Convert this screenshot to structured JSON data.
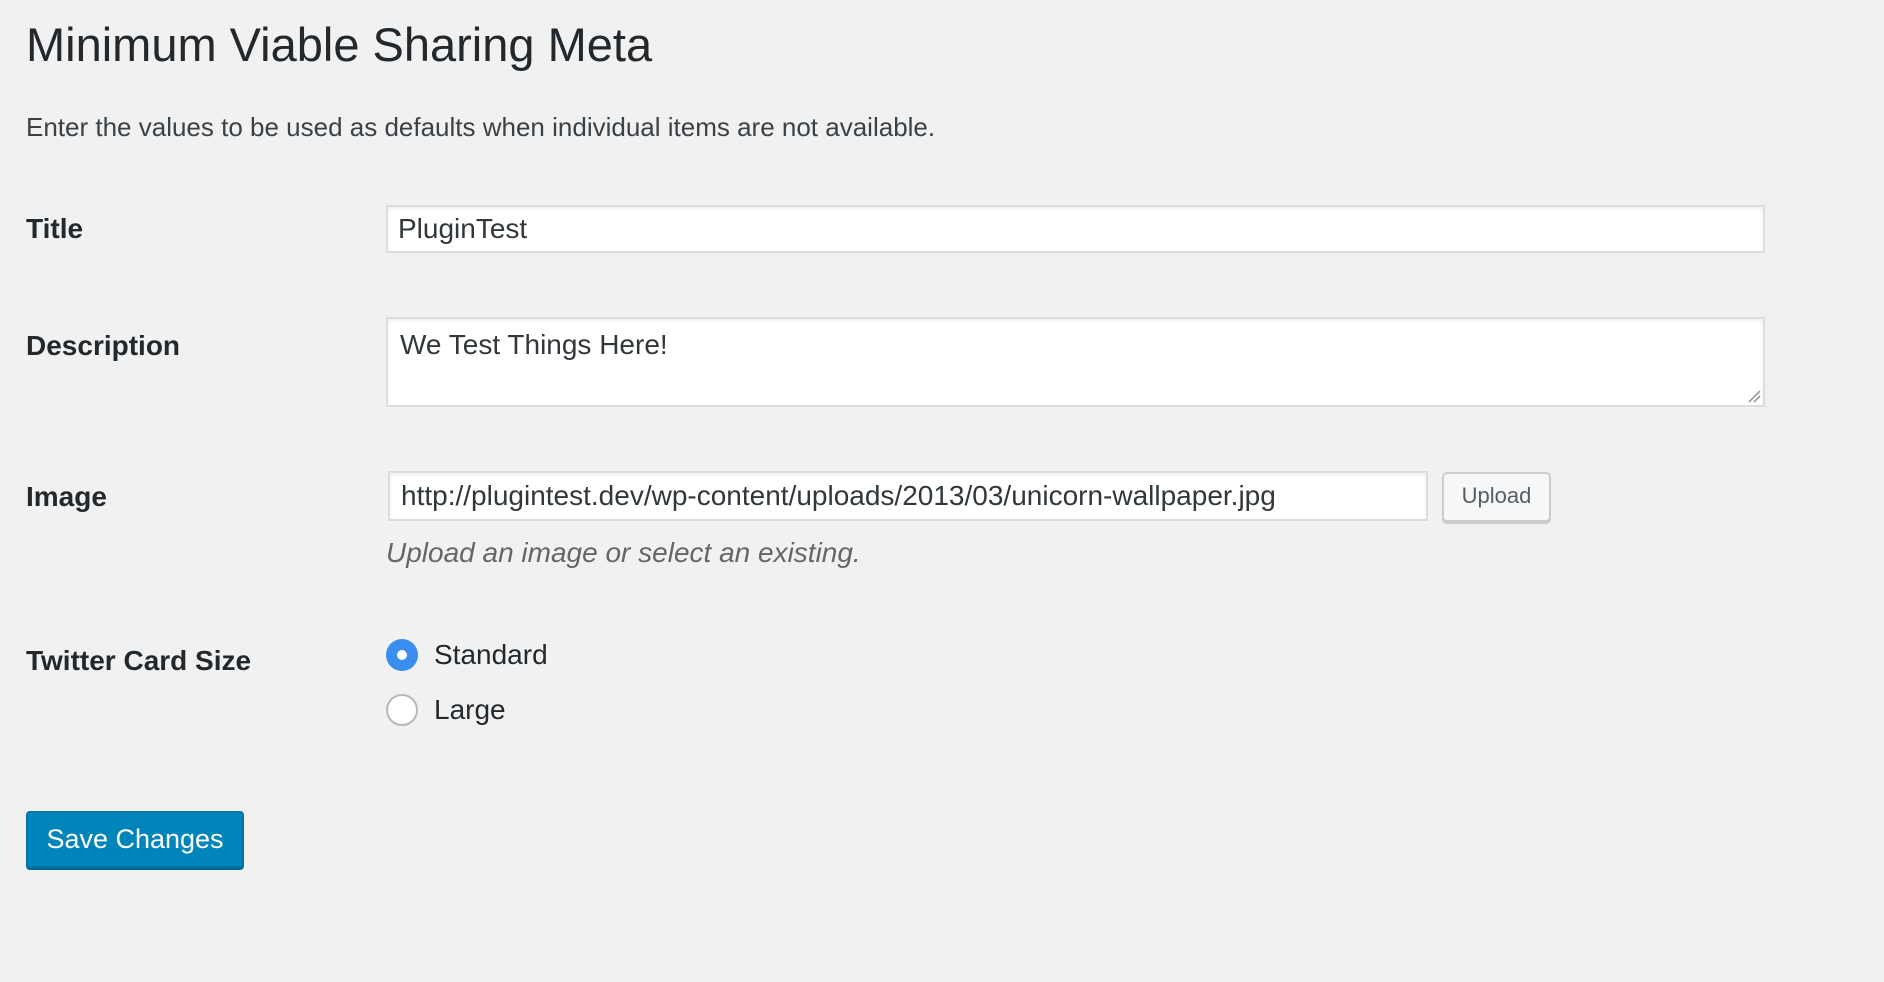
{
  "page": {
    "title": "Minimum Viable Sharing Meta",
    "intro": "Enter the values to be used as defaults when individual items are not available."
  },
  "fields": {
    "title": {
      "label": "Title",
      "value": "PluginTest"
    },
    "description": {
      "label": "Description",
      "value": "We Test Things Here!"
    },
    "image": {
      "label": "Image",
      "value": "http://plugintest.dev/wp-content/uploads/2013/03/unicorn-wallpaper.jpg",
      "upload_label": "Upload",
      "help": "Upload an image or select an existing."
    },
    "twitter_card_size": {
      "label": "Twitter Card Size",
      "options": [
        {
          "label": "Standard",
          "checked": true
        },
        {
          "label": "Large",
          "checked": false
        }
      ]
    }
  },
  "actions": {
    "save_label": "Save Changes"
  },
  "colors": {
    "background": "#f1f1f1",
    "primary_button": "#0085ba",
    "radio_checked": "#3a8ef0"
  }
}
